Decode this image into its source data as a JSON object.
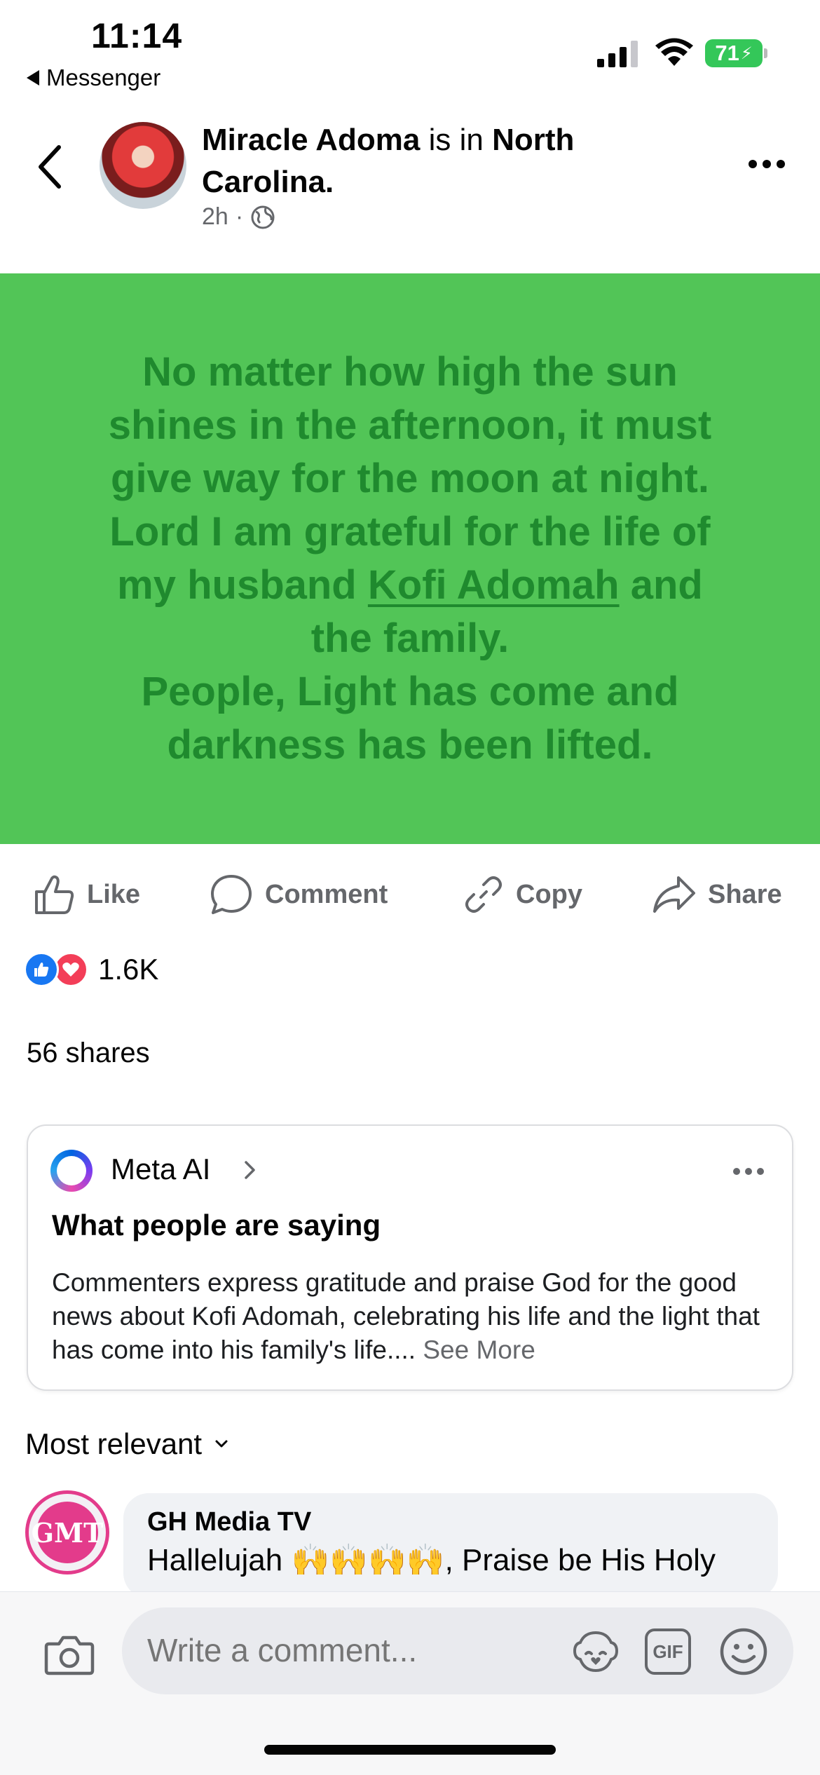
{
  "status_bar": {
    "time": "11:14",
    "back_app": "Messenger",
    "battery": "71"
  },
  "post": {
    "author": "Miracle Adoma",
    "connector": "is in",
    "location": "North Carolina.",
    "time_ago": "2h",
    "separator": "·",
    "privacy_icon": "globe-icon",
    "quote_lines": [
      "No matter how high the sun",
      "shines in the afternoon, it must",
      "give way for the moon at night.",
      "Lord I am grateful for the life of",
      "my husband",
      "Kofi Adomah",
      "and",
      "the family.",
      "People, Light has come and",
      "darkness has been lifted."
    ],
    "card_color": "#52c557",
    "text_color": "#1f8a2e"
  },
  "actions": {
    "like": "Like",
    "comment": "Comment",
    "copy": "Copy",
    "share": "Share"
  },
  "reactions": {
    "count": "1.6K",
    "types": [
      "like",
      "love"
    ]
  },
  "shares": "56 shares",
  "meta_ai": {
    "name": "Meta AI",
    "heading": "What people are saying",
    "summary": "Commenters express gratitude and praise God for the good news about Kofi Adomah, celebrating his life and the light that has come into his family's life.... ",
    "see_more": "See More"
  },
  "comments": {
    "sort_label": "Most relevant",
    "items": [
      {
        "author": "GH Media TV",
        "avatar_text": "GMT",
        "text": "Hallelujah 🙌🙌🙌🙌, Praise be His Holy"
      }
    ]
  },
  "composer": {
    "placeholder": "Write a comment...",
    "gif_label": "GIF"
  }
}
